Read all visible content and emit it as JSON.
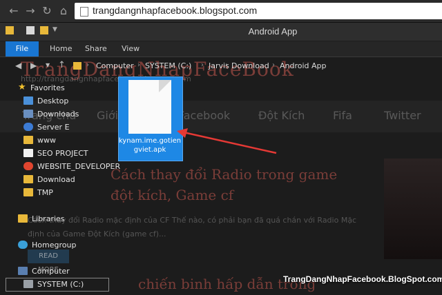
{
  "browser": {
    "url": "trangdangnhapfacebook.blogspot.com",
    "back_icon": "arrow-left",
    "forward_icon": "arrow-right",
    "reload_icon": "reload",
    "home_icon": "home"
  },
  "window": {
    "title": "Android App"
  },
  "ribbon": {
    "tabs": [
      "File",
      "Home",
      "Share",
      "View"
    ]
  },
  "address": {
    "crumbs": [
      "Computer",
      "SYSTEM (C:)",
      "Jarvis",
      "Download",
      "Android App"
    ]
  },
  "sidebar": {
    "favorites_label": "Favorites",
    "favorites": [
      "Desktop",
      "Downloads",
      "Server E",
      "www",
      "SEO PROJECT",
      "WEBSITE_DEVELOPER",
      "Download",
      "TMP"
    ],
    "libraries_label": "Libraries",
    "homegroup_label": "Homegroup",
    "computer_label": "Computer",
    "drive_label": "SYSTEM (C:)"
  },
  "file": {
    "name": "kynam.ime.gotiengviet.apk"
  },
  "background_site": {
    "logo": "TrangDangNhapFaceBook",
    "subtitle": "http://trangdangnhapfacebook.blogspot.com",
    "nav": [
      "Trang chủ",
      "Giới thiệu",
      "Facebook",
      "Đột Kích",
      "Fifa",
      "Twitter"
    ],
    "headline": "Cách thay đổi Radio trong game đột kích, Game cf",
    "excerpt": "Cách thay đổi Radio mặc định của CF Thế nào, có phải bạn đã quá chán với Radio Mặc định của Game Đột Kích (game cf)...",
    "read_more": "READ MORE",
    "headline2": "chiến binh hấp dẫn trong"
  },
  "watermark": "TrangDangNhapFacebook.BlogSpot.com",
  "colors": {
    "accent": "#1976d2",
    "selection": "#1e88e5",
    "arrow": "#e53935"
  }
}
